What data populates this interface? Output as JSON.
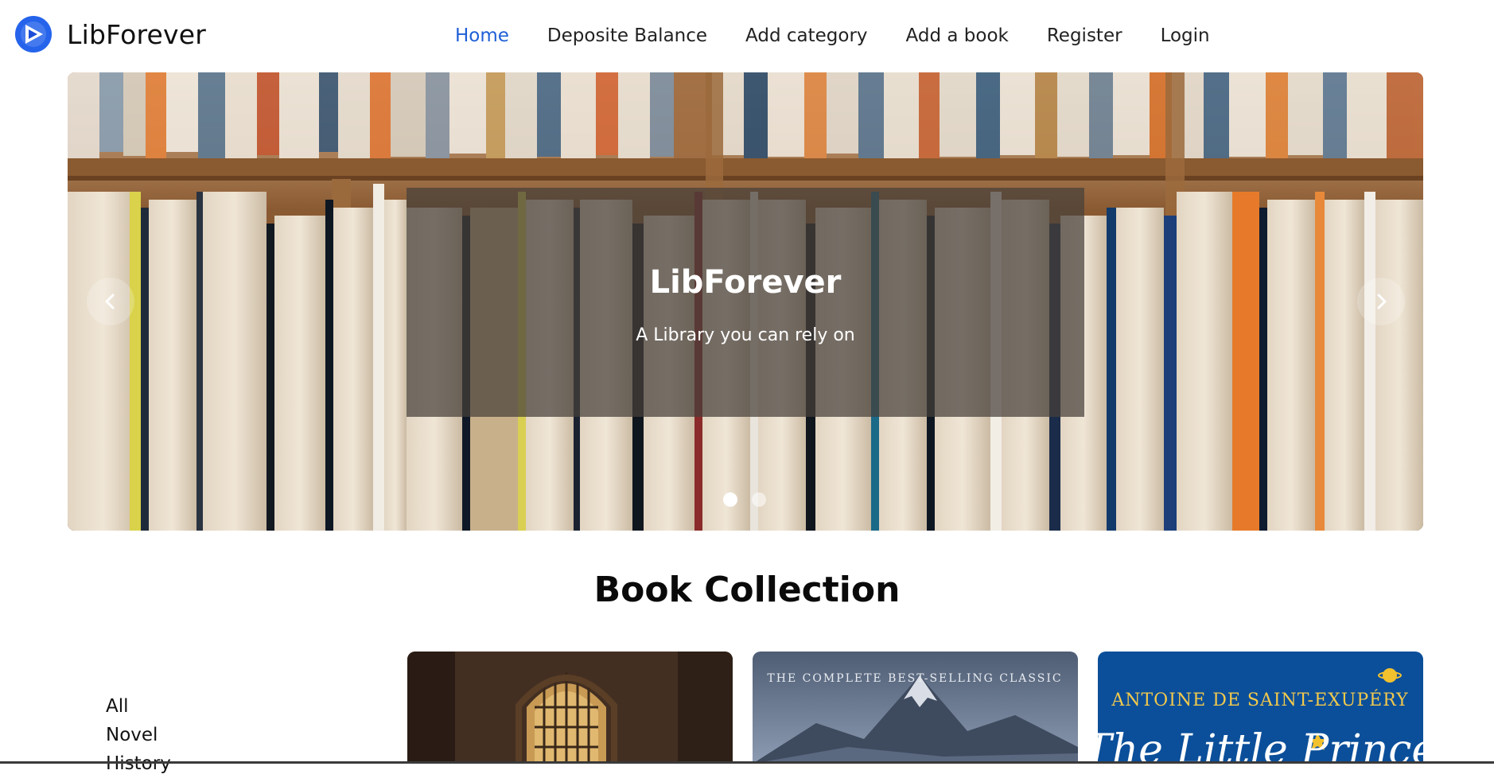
{
  "brand": {
    "name": "LibForever",
    "logo_icon": "play-circle-icon",
    "logo_color": "#2563eb"
  },
  "nav": {
    "items": [
      {
        "label": "Home",
        "active": true
      },
      {
        "label": "Deposite Balance",
        "active": false
      },
      {
        "label": "Add category",
        "active": false
      },
      {
        "label": "Add a book",
        "active": false
      },
      {
        "label": "Register",
        "active": false
      },
      {
        "label": "Login",
        "active": false
      }
    ],
    "active_color": "#1f5fd6"
  },
  "carousel": {
    "caption_title": "LibForever",
    "caption_text": "A Library you can rely on",
    "prev_icon": "chevron-left-icon",
    "next_icon": "chevron-right-icon",
    "slide_count": 2,
    "active_slide": 1
  },
  "collection": {
    "title": "Book Collection",
    "categories": [
      "All",
      "Novel",
      "History"
    ],
    "books": [
      {
        "cover_text": ""
      },
      {
        "cover_text": "THE COMPLETE BEST-SELLING CLASSIC"
      },
      {
        "cover_text": "ANTOINE DE SAINT-EXUPÉRY",
        "cover_title": "The Little Prince"
      }
    ]
  }
}
